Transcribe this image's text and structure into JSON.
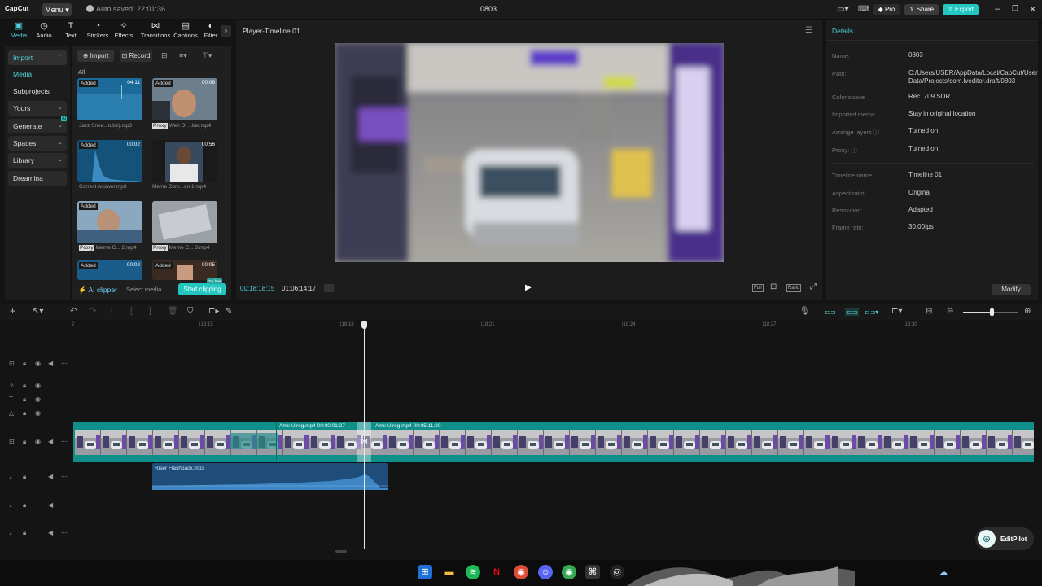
{
  "app": {
    "logo": "CapCut",
    "menu_label": "Menu",
    "autosave": "Auto saved: 22:01:36",
    "project_title": "0803",
    "pro_label": "Pro",
    "share_label": "Share",
    "export_label": "Export"
  },
  "tabs": [
    {
      "label": "Media",
      "icon": "media-icon"
    },
    {
      "label": "Audio",
      "icon": "audio-icon"
    },
    {
      "label": "Text",
      "icon": "text-icon"
    },
    {
      "label": "Stickers",
      "icon": "stickers-icon"
    },
    {
      "label": "Effects",
      "icon": "effects-icon"
    },
    {
      "label": "Transitions",
      "icon": "transitions-icon"
    },
    {
      "label": "Captions",
      "icon": "captions-icon"
    },
    {
      "label": "Filter",
      "icon": "filter-icon"
    }
  ],
  "sidebar": {
    "items": [
      {
        "label": "Import",
        "chevron": "^"
      },
      {
        "label": "Media",
        "chevron": ""
      },
      {
        "label": "Subprojects",
        "chevron": ""
      },
      {
        "label": "Yours",
        "chevron": "v"
      },
      {
        "label": "Generate",
        "chevron": "v"
      },
      {
        "label": "Spaces",
        "chevron": "v"
      },
      {
        "label": "Library",
        "chevron": "v"
      },
      {
        "label": "Dreamina",
        "chevron": ""
      }
    ]
  },
  "media": {
    "import_label": "Import",
    "record_label": "Record",
    "section_label": "All",
    "items": [
      {
        "tag": "Added",
        "duration": "04:11",
        "name": "Jazz Snea...tube).mp3",
        "proxy": ""
      },
      {
        "tag": "Added",
        "duration": "00:08",
        "name": "Weh Di ...bel.mp4",
        "proxy": "Proxy"
      },
      {
        "tag": "Added",
        "duration": "00:02",
        "name": "Correct Answer.mp3",
        "proxy": ""
      },
      {
        "tag": "",
        "duration": "00:56",
        "name": "Meme Com...on 1.mp4",
        "proxy": ""
      },
      {
        "tag": "Added",
        "duration": "",
        "name": "Meme C... 2.mp4",
        "proxy": "Proxy"
      },
      {
        "tag": "",
        "duration": "",
        "name": "Meme C... 3.mp4",
        "proxy": "Proxy"
      },
      {
        "tag": "Added",
        "duration": "00:02",
        "name": "",
        "proxy": ""
      },
      {
        "tag": "Added",
        "duration": "00:05",
        "name": "",
        "proxy": ""
      }
    ],
    "ai_clipper_label": "AI clipper",
    "select_media_label": "Select media ...",
    "start_clipping_label": "Start clipping",
    "free_badge": "Try free"
  },
  "player": {
    "title": "Player-Timeline 01",
    "current_time": "00:18:18:15",
    "total_time": "01:06:14:17",
    "full_label": "Full",
    "ratio_label": "Ratio"
  },
  "details": {
    "title": "Details",
    "rows": [
      {
        "label": "Name:",
        "value": "0803"
      },
      {
        "label": "Path:",
        "value": "C:/Users/USER/AppData/Local/CapCut/User Data/Projects/com.lveditor.draft/0803"
      },
      {
        "label": "Color space",
        "value": "Rec. 709 SDR"
      },
      {
        "label": "Imported media:",
        "value": "Stay in original location"
      },
      {
        "label": "Arrange layers",
        "value": "Turned on"
      },
      {
        "label": "Proxy:",
        "value": "Turned on"
      },
      {
        "label": "Timeline name",
        "value": "Timeline 01"
      },
      {
        "label": "Aspect ratio:",
        "value": "Original"
      },
      {
        "label": "Resolution:",
        "value": "Adapted"
      },
      {
        "label": "Frame rate:",
        "value": "30.00fps"
      }
    ],
    "modify_label": "Modify"
  },
  "timeline": {
    "ruler": [
      "|18:15",
      "|18:18",
      "|18:21",
      "|18:24",
      "|18:27",
      "|18:30"
    ],
    "clip1_label": "Ams Ulrog.mp4   00:00:01:27",
    "clip2_label": "Ams Ulrog.mp4   00:05:11:20",
    "audio_label": "Riser Flashback.mp3"
  },
  "editpilot": "EditPilot",
  "colors": {
    "accent": "#4fd1d9",
    "export": "#22c7c0",
    "video_track": "#0f8f8a",
    "audio_track": "#1e4d7a"
  }
}
